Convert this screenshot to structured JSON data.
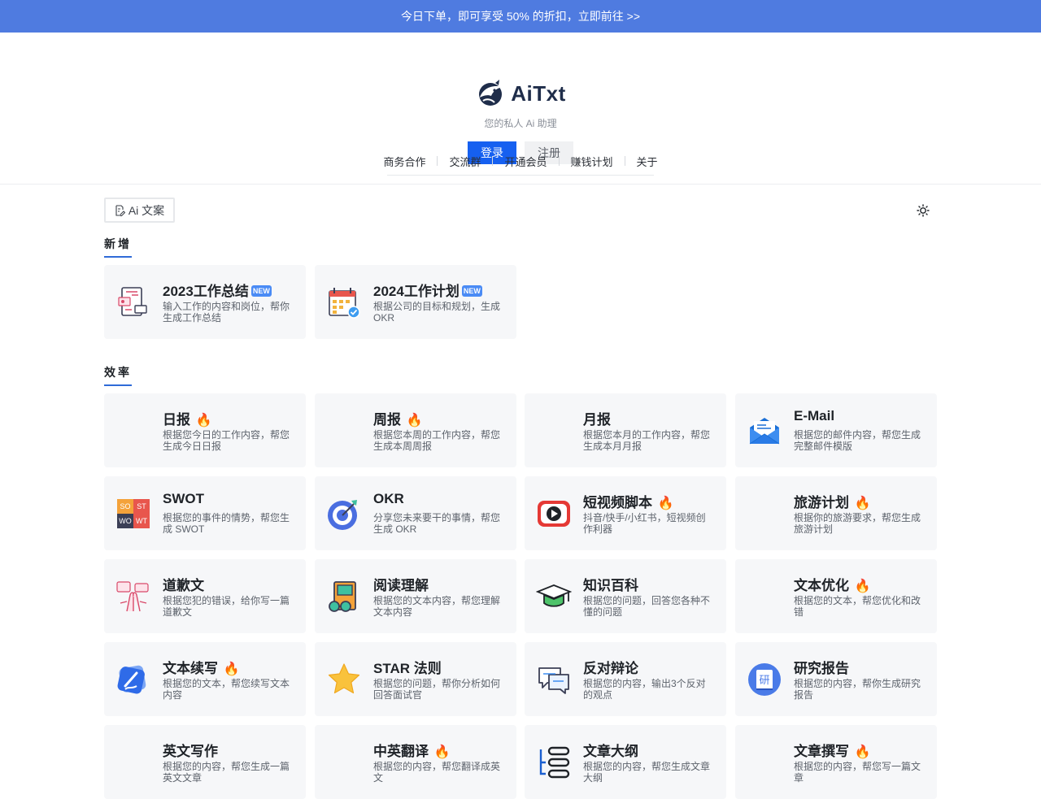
{
  "banner": {
    "text": "今日下单，即可享受 50% 的折扣，立即前往 >>"
  },
  "brand": {
    "name": "AiTxt",
    "tagline": "您的私人 Ai 助理"
  },
  "auth": {
    "login": "登录",
    "register": "注册"
  },
  "nav": [
    "商务合作",
    "交流群",
    "开通会员",
    "赚钱计划",
    "关于"
  ],
  "category_tag": "Ai 文案",
  "sections": {
    "new": {
      "title": "新增"
    },
    "efficiency": {
      "title": "效率"
    }
  },
  "new_cards": [
    {
      "title": "2023工作总结",
      "badge": "NEW",
      "desc": "输入工作的内容和岗位，帮你生成工作总结",
      "icon": "report-doc-icon"
    },
    {
      "title": "2024工作计划",
      "badge": "NEW",
      "desc": "根据公司的目标和规划，生成 OKR",
      "icon": "calendar-check-icon"
    }
  ],
  "cards": [
    {
      "title": "日报",
      "hot": "🔥",
      "desc": "根据您今日的工作内容，帮您生成今日日报",
      "icon": "none"
    },
    {
      "title": "周报",
      "hot": "🔥",
      "desc": "根据您本周的工作内容，帮您生成本周周报",
      "icon": "none"
    },
    {
      "title": "月报",
      "hot": "",
      "desc": "根据您本月的工作内容，帮您生成本月月报",
      "icon": "none"
    },
    {
      "title": "E-Mail",
      "hot": "",
      "desc": "根据您的邮件内容，帮您生成完整邮件模版",
      "icon": "envelope-icon"
    },
    {
      "title": "SWOT",
      "hot": "",
      "desc": "根据您的事件的情势，帮您生成 SWOT",
      "icon": "swot-grid-icon"
    },
    {
      "title": "OKR",
      "hot": "",
      "desc": "分享您未来要干的事情，帮您生成 OKR",
      "icon": "target-icon"
    },
    {
      "title": "短视频脚本",
      "hot": "🔥",
      "desc": "抖音/快手/小红书，短视频创作利器",
      "icon": "play-button-icon"
    },
    {
      "title": "旅游计划",
      "hot": "🔥",
      "desc": "根据你的旅游要求，帮您生成旅游计划",
      "icon": "none"
    },
    {
      "title": "道歉文",
      "hot": "",
      "desc": "根据您犯的错误，给你写一篇道歉文",
      "icon": "apology-hands-icon"
    },
    {
      "title": "阅读理解",
      "hot": "",
      "desc": "根据您的文本内容，帮您理解文本内容",
      "icon": "book-glasses-icon"
    },
    {
      "title": "知识百科",
      "hot": "",
      "desc": "根据您的问题，回答您各种不懂的问题",
      "icon": "graduation-cap-icon"
    },
    {
      "title": "文本优化",
      "hot": "🔥",
      "desc": "根据您的文本，帮您优化和改错",
      "icon": "none"
    },
    {
      "title": "文本续写",
      "hot": "🔥",
      "desc": "根据您的文本，帮您续写文本内容",
      "icon": "pen-card-icon"
    },
    {
      "title": "STAR 法则",
      "hot": "",
      "desc": "根据您的问题，帮你分析如何回答面试官",
      "icon": "star-icon"
    },
    {
      "title": "反对辩论",
      "hot": "",
      "desc": "根据您的内容，输出3个反对的观点",
      "icon": "chat-bubbles-icon"
    },
    {
      "title": "研究报告",
      "hot": "",
      "desc": "根据您的内容，帮你生成研究报告",
      "icon": "research-book-icon"
    },
    {
      "title": "英文写作",
      "hot": "",
      "desc": "根据您的内容，帮您生成一篇英文文章",
      "icon": "none"
    },
    {
      "title": "中英翻译",
      "hot": "🔥",
      "desc": "根据您的内容，帮您翻译成英文",
      "icon": "none"
    },
    {
      "title": "文章大纲",
      "hot": "",
      "desc": "根据您的内容，帮您生成文章大纲",
      "icon": "outline-list-icon"
    },
    {
      "title": "文章撰写",
      "hot": "🔥",
      "desc": "根据您的内容，帮您写一篇文章",
      "icon": "none"
    }
  ],
  "swot_labels": [
    "SO",
    "ST",
    "WO",
    "WT"
  ],
  "research_glyph": "研",
  "colors": {
    "banner": "#4f7be0",
    "primary": "#1660f0",
    "card_bg": "#f6f7f9",
    "accent_line": "#2f6bd8",
    "fire": "#f06a1d"
  }
}
